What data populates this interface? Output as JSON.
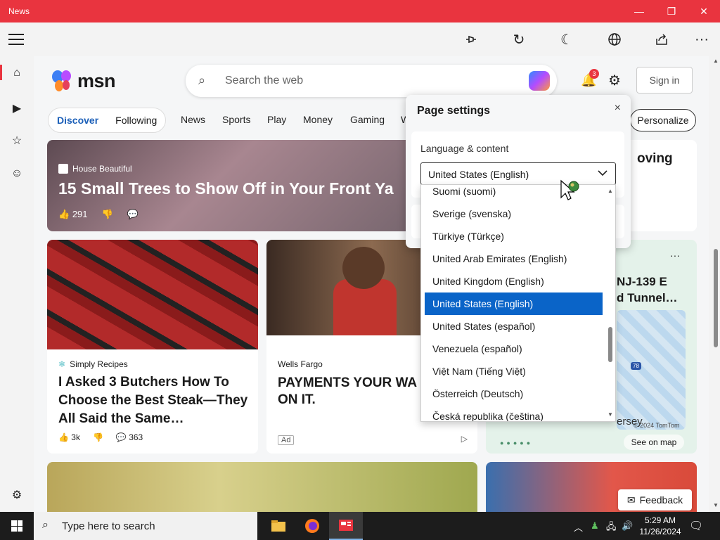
{
  "window": {
    "title": "News"
  },
  "search": {
    "placeholder": "Search the web"
  },
  "header": {
    "logo_text": "msn",
    "notification_count": "3",
    "signin_label": "Sign in"
  },
  "nav": {
    "discover": "Discover",
    "following": "Following",
    "items": [
      "News",
      "Sports",
      "Play",
      "Money",
      "Gaming",
      "W"
    ],
    "personalize": "Personalize"
  },
  "hero": {
    "source": "House Beautiful",
    "headline": "15 Small Trees to Show Off in Your Front Ya",
    "likes": "291"
  },
  "right_card": {
    "headline": "oving"
  },
  "steak_card": {
    "source": "Simply Recipes",
    "headline": "I Asked 3 Butchers How To Choose the Best Steak—They All Said the Same…",
    "likes": "3k",
    "comments": "363"
  },
  "ad_card": {
    "source": "Wells Fargo",
    "headline": "PAYMENTS YOUR WA BANK ON IT.",
    "ad_label": "Ad"
  },
  "map_card": {
    "more": "···",
    "headline_line1": "NJ-139 E",
    "headline_line2": "d Tunnel…",
    "map_label": "ersey",
    "copyright": "© 2024 TomTom",
    "see_map": "See on map",
    "marker": "78"
  },
  "feedback": {
    "label": "Feedback"
  },
  "page_settings": {
    "title": "Page settings",
    "close": "×",
    "section_label": "Language & content",
    "selected_language": "United States (English)"
  },
  "language_options": [
    "Suomi (suomi)",
    "Sverige (svenska)",
    "Türkiye (Türkçe)",
    "United Arab Emirates (English)",
    "United Kingdom (English)",
    "United States (English)",
    "United States (español)",
    "Venezuela (español)",
    "Việt Nam (Tiếng Việt)",
    "Österreich (Deutsch)",
    "Česká republika (čeština)"
  ],
  "taskbar": {
    "search_placeholder": "Type here to search",
    "time": "5:29 AM",
    "date": "11/26/2024"
  },
  "colors": {
    "accent": "#e9343f",
    "selection": "#0a64c8",
    "link": "#1b5fb8"
  }
}
